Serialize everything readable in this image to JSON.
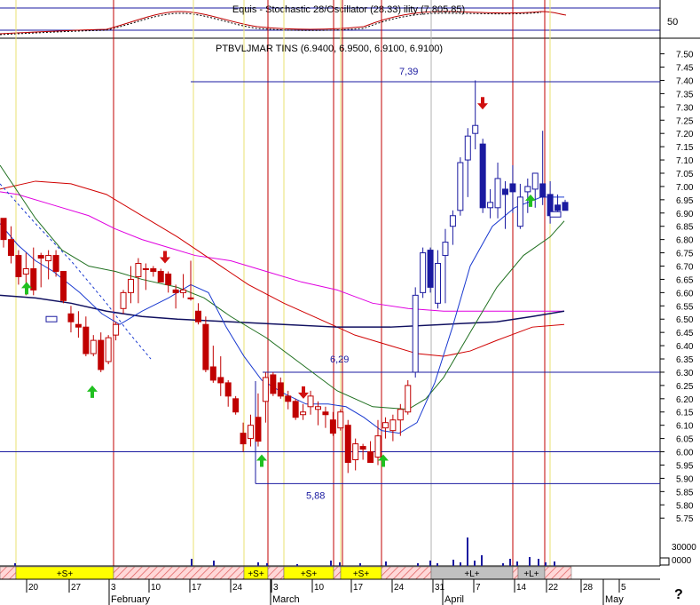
{
  "header": {
    "overlay_text": "Equis - Stochastic 28/Oscillator (28.33) ility (7,805.85)",
    "right_value": "50"
  },
  "chart_data": {
    "type": "candlestick",
    "instrument_label": "PTBVLJMAR TINS (6.9400, 6.9500, 6.9100, 6.9100)",
    "ylim": [
      5.75,
      7.5
    ],
    "ticks": [
      "7.50",
      "7.45",
      "7.40",
      "7.35",
      "7.30",
      "7.25",
      "7.20",
      "7.15",
      "7.10",
      "7.05",
      "7.00",
      "6.95",
      "6.90",
      "6.85",
      "6.80",
      "6.75",
      "6.70",
      "6.65",
      "6.60",
      "6.55",
      "6.50",
      "6.45",
      "6.40",
      "6.35",
      "6.30",
      "6.25",
      "6.20",
      "6.15",
      "6.10",
      "6.05",
      "6.00",
      "5.95",
      "5.90",
      "5.85",
      "5.80",
      "5.75"
    ],
    "x_ticks": [
      "20",
      "27",
      "3",
      "10",
      "17",
      "24",
      "3",
      "10",
      "17",
      "24",
      "31",
      "7",
      "14",
      "22",
      "28",
      "5"
    ],
    "months": [
      "February",
      "March",
      "April",
      "May"
    ],
    "levels": [
      {
        "label": "7,39",
        "value": 7.395
      },
      {
        "label": "6,29",
        "value": 6.3
      },
      {
        "label": "5,88",
        "value": 5.88
      },
      {
        "label": "",
        "value": 6.0
      }
    ],
    "candles": [
      [
        6.88,
        6.85,
        6.77,
        6.8
      ],
      [
        6.8,
        6.85,
        6.71,
        6.74
      ],
      [
        6.74,
        6.76,
        6.63,
        6.66
      ],
      [
        6.67,
        6.75,
        6.59,
        6.69
      ],
      [
        6.69,
        6.77,
        6.59,
        6.61
      ],
      [
        6.74,
        6.75,
        6.62,
        6.73
      ],
      [
        6.72,
        6.76,
        6.65,
        6.74
      ],
      [
        6.74,
        6.76,
        6.66,
        6.68
      ],
      [
        6.68,
        6.68,
        6.56,
        6.57
      ],
      [
        6.52,
        6.55,
        6.45,
        6.49
      ],
      [
        6.48,
        6.53,
        6.43,
        6.47
      ],
      [
        6.47,
        6.51,
        6.36,
        6.37
      ],
      [
        6.37,
        6.44,
        6.36,
        6.42
      ],
      [
        6.42,
        6.45,
        6.3,
        6.31
      ],
      [
        6.34,
        6.44,
        6.33,
        6.43
      ],
      [
        6.44,
        6.49,
        6.42,
        6.48
      ],
      [
        6.54,
        6.61,
        6.52,
        6.6
      ],
      [
        6.6,
        6.7,
        6.56,
        6.65
      ],
      [
        6.66,
        6.73,
        6.56,
        6.71
      ],
      [
        6.69,
        6.71,
        6.61,
        6.69
      ],
      [
        6.69,
        6.7,
        6.66,
        6.68
      ],
      [
        6.68,
        6.69,
        6.64,
        6.64
      ],
      [
        6.67,
        6.68,
        6.6,
        6.63
      ],
      [
        6.61,
        6.63,
        6.54,
        6.6
      ],
      [
        6.6,
        6.67,
        6.58,
        6.61
      ],
      [
        6.58,
        6.72,
        6.57,
        6.58
      ],
      [
        6.53,
        6.56,
        6.48,
        6.49
      ],
      [
        6.48,
        6.51,
        6.3,
        6.31
      ],
      [
        6.32,
        6.4,
        6.26,
        6.27
      ],
      [
        6.28,
        6.36,
        6.21,
        6.26
      ],
      [
        6.26,
        6.27,
        6.17,
        6.21
      ],
      [
        6.2,
        6.21,
        6.14,
        6.15
      ],
      [
        6.07,
        6.11,
        6.0,
        6.03
      ],
      [
        6.05,
        6.14,
        6.02,
        6.1
      ],
      [
        6.13,
        6.22,
        6.02,
        6.04
      ],
      [
        6.19,
        6.3,
        6.11,
        6.28
      ],
      [
        6.29,
        6.3,
        6.21,
        6.22
      ],
      [
        6.26,
        6.28,
        6.2,
        6.21
      ],
      [
        6.21,
        6.23,
        6.16,
        6.19
      ],
      [
        6.19,
        6.2,
        6.12,
        6.13
      ],
      [
        6.14,
        6.18,
        6.12,
        6.15
      ],
      [
        6.17,
        6.23,
        6.14,
        6.21
      ],
      [
        6.16,
        6.19,
        6.1,
        6.17
      ],
      [
        6.15,
        6.17,
        6.09,
        6.14
      ],
      [
        6.12,
        6.15,
        6.06,
        6.07
      ],
      [
        6.09,
        6.16,
        6.08,
        6.15
      ],
      [
        6.1,
        6.12,
        5.92,
        5.96
      ],
      [
        5.97,
        6.05,
        5.93,
        6.03
      ],
      [
        6.02,
        6.03,
        5.97,
        6.01
      ],
      [
        6.0,
        6.04,
        5.96,
        5.96
      ],
      [
        5.98,
        6.12,
        5.95,
        6.06
      ],
      [
        6.09,
        6.13,
        6.05,
        6.11
      ],
      [
        6.08,
        6.14,
        6.04,
        6.12
      ],
      [
        6.12,
        6.18,
        6.06,
        6.16
      ],
      [
        6.15,
        6.27,
        6.14,
        6.25
      ],
      [
        6.3,
        6.62,
        6.28,
        6.59
      ],
      [
        6.6,
        6.77,
        6.58,
        6.75
      ],
      [
        6.76,
        6.77,
        6.6,
        6.62
      ],
      [
        6.56,
        6.76,
        6.54,
        6.71
      ],
      [
        6.74,
        6.84,
        6.56,
        6.79
      ],
      [
        6.85,
        6.91,
        6.78,
        6.89
      ],
      [
        6.91,
        7.11,
        6.89,
        7.09
      ],
      [
        7.1,
        7.22,
        6.96,
        7.19
      ],
      [
        7.2,
        7.4,
        7.14,
        7.23
      ],
      [
        7.16,
        7.18,
        6.9,
        6.92
      ],
      [
        6.92,
        6.99,
        6.88,
        6.94
      ],
      [
        6.92,
        7.09,
        6.88,
        7.03
      ],
      [
        6.99,
        7.02,
        6.84,
        6.97
      ],
      [
        7.01,
        7.08,
        6.9,
        6.98
      ],
      [
        6.85,
        7.01,
        6.84,
        6.96
      ],
      [
        6.98,
        7.03,
        6.9,
        7.0
      ],
      [
        6.99,
        7.05,
        6.92,
        7.05
      ],
      [
        7.01,
        7.21,
        6.93,
        6.96
      ],
      [
        6.97,
        7.02,
        6.86,
        6.89
      ],
      [
        6.93,
        6.97,
        6.9,
        6.91
      ],
      [
        6.94,
        6.95,
        6.91,
        6.91
      ]
    ]
  },
  "bottom_bar": {
    "segments": [
      "+S+",
      "+S+",
      "+S+",
      "+S+",
      "+L+",
      "+L+"
    ],
    "volume_ticks": [
      "30000",
      "0000"
    ],
    "help": "?"
  }
}
